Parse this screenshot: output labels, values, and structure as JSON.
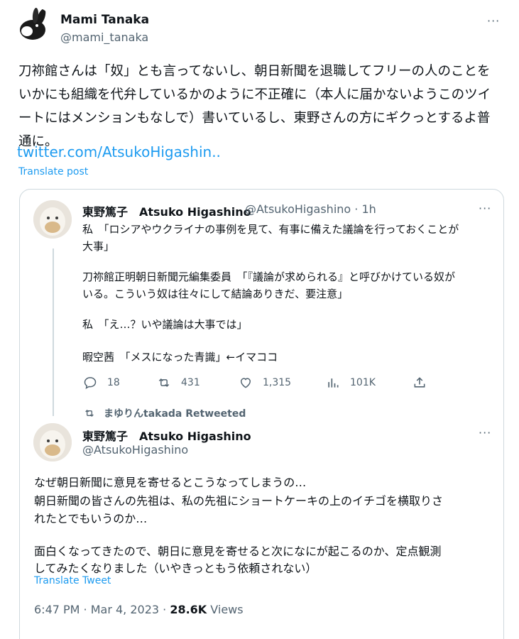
{
  "outer": {
    "author_name": "Mami Tanaka",
    "author_handle": "@mami_tanaka",
    "more": "···",
    "body": "刀祢館さんは「奴」とも言ってないし、朝日新聞を退職してフリーの人のことを\nいかにも組織を代弁しているかのように不正確に（本人に届かないようこのツイ\nートにはメンションもなしで）書いているし、東野さんの方にギクっとするよ普\n通に。",
    "link": "twitter.com/AtsukoHigashin..",
    "translate": "Translate post"
  },
  "quote": {
    "first": {
      "name": "東野篤子　Atsuko Higashino",
      "meta": "@AtsukoHigashino · 1h",
      "more": "···",
      "lines": [
        "私　「ロシアやウクライナの事例を見て、有事に備えた議論を行っておくことが",
        "大事」",
        "刀祢館正明朝日新聞元編集委員　「『議論が求められる』と呼びかけている奴が",
        "いる。こういう奴は往々にして結論ありきだ、要注意」",
        "私　「え…？いや議論は大事では」",
        "暇空茜　「メスになった青識」←イマココ"
      ],
      "actions": {
        "replies": "18",
        "retweets": "431",
        "likes": "1,315",
        "views": "101K"
      }
    },
    "retweeted_by": "まゆりんtakada Retweeted",
    "second": {
      "name": "東野篤子　Atsuko Higashino",
      "handle": "@AtsukoHigashino",
      "more": "···",
      "lines": [
        "なぜ朝日新聞に意見を寄せるとこうなってしまうの…",
        "朝日新聞の皆さんの先祖は、私の先祖にショートケーキの上のイチゴを横取りさ",
        "れたとでもいうのか…",
        "面白くなってきたので、朝日に意見を寄せると次になにが起こるのか、定点観測",
        "してみたくなりました（いやきっともう依頼されない）"
      ],
      "translate": "Translate Tweet",
      "timestamp": "6:47 PM · Mar 4, 2023 · ",
      "views_count": "28.6K",
      "views_label": " Views"
    }
  },
  "colors": {
    "accent": "#1d9bf0",
    "secondary_text": "#536471",
    "border": "#cfd9de"
  }
}
